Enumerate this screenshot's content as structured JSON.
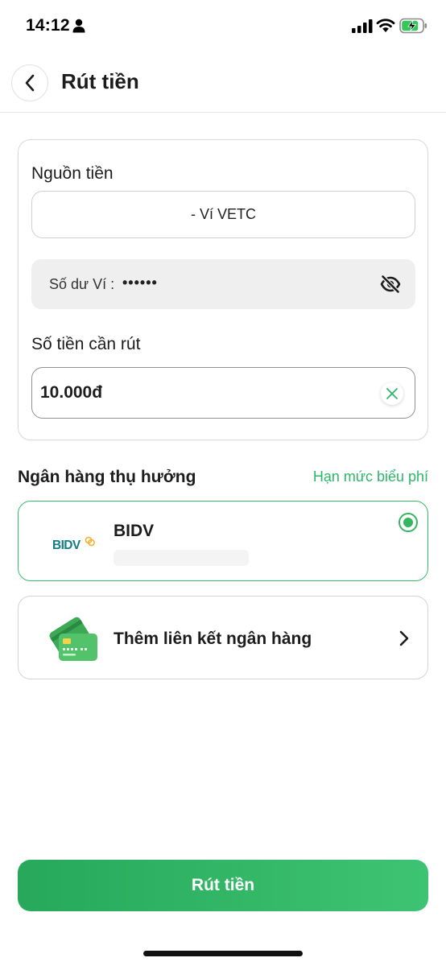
{
  "status_bar": {
    "time": "14:12"
  },
  "header": {
    "title": "Rút tiền"
  },
  "source": {
    "label": "Nguồn tiền",
    "wallet_value": "- Ví VETC",
    "balance_label": "Số dư Ví :",
    "balance_value": "••••••"
  },
  "amount": {
    "label": "Số tiền cần rút",
    "value": "10.000đ"
  },
  "beneficiary": {
    "title": "Ngân hàng thụ hưởng",
    "fee_link": "Hạn mức biểu phí",
    "selected_bank": {
      "logo_text": "BIDV",
      "name": "BIDV"
    },
    "add_bank_label": "Thêm liên kết ngân hàng"
  },
  "actions": {
    "withdraw_label": "Rút tiền"
  },
  "colors": {
    "accent": "#2db768",
    "button_gradient_start": "#27a85a",
    "button_gradient_end": "#3dc472",
    "bidv_teal": "#127c84",
    "bidv_gold": "#f2b233"
  },
  "icons": [
    "person-icon",
    "signal-icon",
    "wifi-icon",
    "battery-icon",
    "back-icon",
    "eye-off-icon",
    "clear-icon",
    "radio-selected-icon",
    "card-stack-icon",
    "chevron-right-icon"
  ]
}
